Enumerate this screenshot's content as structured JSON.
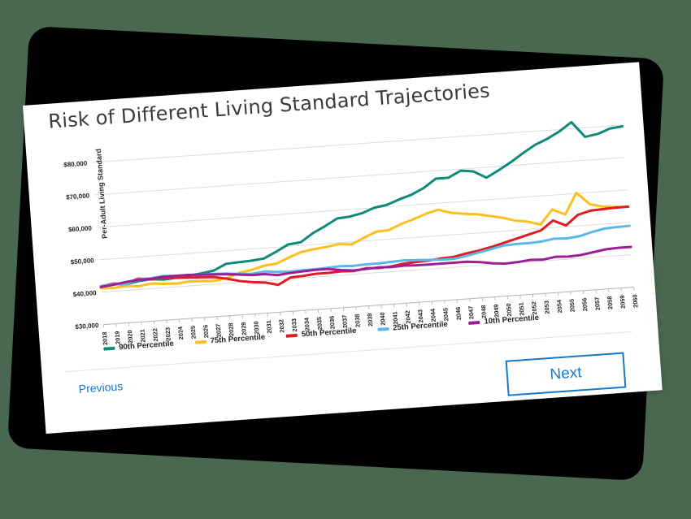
{
  "background_color": "#4a6850",
  "slide": {
    "title": "Risk of Different Living Standard Trajectories"
  },
  "navigation": {
    "previous_label": "Previous",
    "next_label": "Next",
    "link_color": "#1878c8"
  },
  "chart_data": {
    "type": "line",
    "title": "Risk of Different Living Standard Trajectories",
    "xlabel": "",
    "ylabel": "Per-Adult Living Standard",
    "ylim": [
      30000,
      85000
    ],
    "y_ticks": [
      30000,
      40000,
      50000,
      60000,
      70000,
      80000
    ],
    "y_tick_labels": [
      "$30,000",
      "$40,000",
      "$50,000",
      "$60,000",
      "$70,000",
      "$80,000"
    ],
    "grid": true,
    "legend_position": "bottom",
    "x": [
      2018,
      2019,
      2020,
      2021,
      2022,
      2023,
      2024,
      2025,
      2026,
      2027,
      2028,
      2029,
      2030,
      2031,
      2032,
      2033,
      2034,
      2035,
      2036,
      2037,
      2038,
      2039,
      2040,
      2041,
      2042,
      2043,
      2044,
      2045,
      2046,
      2047,
      2048,
      2049,
      2050,
      2051,
      2052,
      2053,
      2054,
      2055,
      2056,
      2057,
      2058,
      2059,
      2060
    ],
    "series": [
      {
        "name": "90th Percentile",
        "color": "#0f8a78",
        "values": [
          41800,
          42200,
          41900,
          42600,
          42900,
          42500,
          42800,
          43200,
          43600,
          44200,
          46000,
          46200,
          46400,
          46800,
          48600,
          50600,
          51000,
          53500,
          55400,
          57500,
          57800,
          58600,
          60000,
          60600,
          62000,
          63200,
          65000,
          67600,
          67600,
          69500,
          69000,
          66800,
          68800,
          71000,
          73500,
          75800,
          77400,
          79400,
          82000,
          77200,
          77800,
          79200,
          79600
        ]
      },
      {
        "name": "75th Percentile",
        "color": "#fbc01e",
        "values": [
          41200,
          41000,
          41400,
          41000,
          41600,
          41200,
          41000,
          41400,
          41200,
          41000,
          41600,
          43000,
          43600,
          44600,
          45000,
          46600,
          48000,
          48600,
          49000,
          49600,
          49200,
          51000,
          52600,
          52800,
          54400,
          55600,
          57000,
          58000,
          56800,
          56200,
          55800,
          55000,
          54200,
          53000,
          52400,
          51200,
          55600,
          53800,
          60200,
          56400,
          55400,
          55000,
          54800
        ]
      },
      {
        "name": "50th Percentile",
        "color": "#e01b22",
        "values": [
          41800,
          42400,
          42000,
          43400,
          42800,
          43200,
          42800,
          42600,
          42400,
          42200,
          41400,
          40400,
          39800,
          39400,
          38400,
          40400,
          40600,
          41000,
          41000,
          41200,
          41000,
          41600,
          41400,
          41600,
          42200,
          42400,
          42600,
          43000,
          43200,
          44000,
          44600,
          45400,
          46400,
          47400,
          48400,
          49400,
          52200,
          50400,
          53400,
          54400,
          54600,
          54800,
          54800
        ]
      },
      {
        "name": "25th Percentile",
        "color": "#5bb6ea",
        "values": [
          41800,
          42200,
          42000,
          43200,
          43200,
          43600,
          43400,
          43400,
          43200,
          43200,
          43000,
          42600,
          42400,
          42800,
          42400,
          42200,
          42400,
          42400,
          42600,
          42800,
          42600,
          42800,
          42800,
          43000,
          43200,
          43000,
          42800,
          42600,
          42600,
          43200,
          44000,
          44800,
          45600,
          45800,
          45800,
          46000,
          46600,
          46400,
          46800,
          47800,
          48600,
          48800,
          48900
        ]
      },
      {
        "name": "10th Percentile",
        "color": "#9c1f96",
        "values": [
          41600,
          42000,
          42600,
          43000,
          43000,
          43400,
          43400,
          43400,
          43200,
          43000,
          42800,
          42400,
          42000,
          42000,
          41400,
          41800,
          42000,
          42200,
          42200,
          41600,
          41200,
          41400,
          41600,
          41400,
          41600,
          41400,
          41400,
          41400,
          41400,
          41400,
          41000,
          40400,
          40000,
          40200,
          40600,
          40400,
          41000,
          40800,
          41000,
          41600,
          42200,
          42400,
          42400
        ]
      }
    ]
  }
}
